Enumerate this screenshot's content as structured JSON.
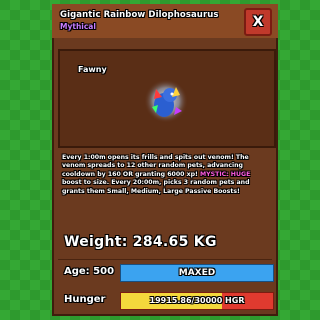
{
  "window": {
    "title": "Gigantic Rainbow Dilophosaurus",
    "rarity": "Mythical",
    "close_label": "X"
  },
  "viewport": {
    "pet_name": "Fawny"
  },
  "description": {
    "line1": "Every 1:00m opens its frills and spits out venom! The venom spreads to 12 other random pets, advancing cooldown by 160 OR granting 6000 xp!",
    "highlight": "MYSTIC: HUGE",
    "line2": " boost to size. Every 20:00m, picks 3 random pets and grants them Small, Medium, Large Passive Boosts!"
  },
  "stats": {
    "weight_label": "Weight: 284.65 KG",
    "age_label": "Age: 500",
    "age_bar_text": "MAXED",
    "age_fill": 1.0,
    "hunger_label": "Hunger",
    "hunger_bar_text": "19915.86/30000 HGR",
    "hunger_fill": 0.664
  },
  "colors": {
    "background": "#2e9a2e",
    "panel": "#6b3a1f",
    "rarity": "#c77dff",
    "age_bar": "#3ba3f0",
    "hunger_fill": "#f4d83c",
    "hunger_empty": "#e03a2f",
    "close_button": "#c0392b"
  }
}
